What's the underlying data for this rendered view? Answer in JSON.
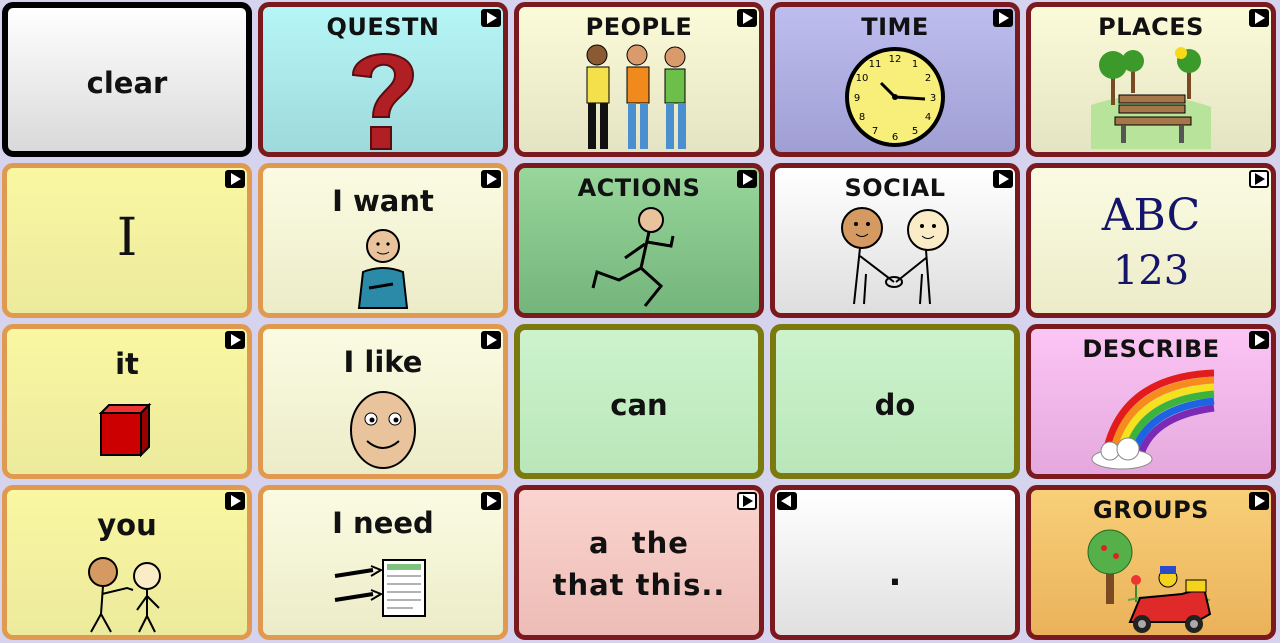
{
  "board": {
    "cells": [
      {
        "id": "clear",
        "label": "clear"
      },
      {
        "id": "questn",
        "label": "QUESTN",
        "picture": "question-mark-icon"
      },
      {
        "id": "people",
        "label": "PEOPLE",
        "picture": "people-icon"
      },
      {
        "id": "time",
        "label": "TIME",
        "picture": "clock-icon"
      },
      {
        "id": "places",
        "label": "PLACES",
        "picture": "park-bench-icon"
      },
      {
        "id": "i",
        "label": "I"
      },
      {
        "id": "i-want",
        "label": "I want",
        "picture": "person-want-icon"
      },
      {
        "id": "actions",
        "label": "ACTIONS",
        "picture": "running-person-icon"
      },
      {
        "id": "social",
        "label": "SOCIAL",
        "picture": "handshake-icon"
      },
      {
        "id": "abc",
        "label": "ABC",
        "label2": "123"
      },
      {
        "id": "it",
        "label": "it",
        "picture": "red-cube-icon"
      },
      {
        "id": "i-like",
        "label": "I like",
        "picture": "smiley-face-icon"
      },
      {
        "id": "can",
        "label": "can"
      },
      {
        "id": "do",
        "label": "do"
      },
      {
        "id": "describe",
        "label": "DESCRIBE",
        "picture": "rainbow-icon"
      },
      {
        "id": "you",
        "label": "you",
        "picture": "pointing-people-icon"
      },
      {
        "id": "i-need",
        "label": "I need",
        "picture": "receipt-hands-icon"
      },
      {
        "id": "articles",
        "label": "a  the",
        "label2": "that this.."
      },
      {
        "id": "period",
        "label": "."
      },
      {
        "id": "groups",
        "label": "GROUPS",
        "picture": "tree-car-icon"
      }
    ],
    "colors": {
      "background": "#d6d3ee",
      "border_maroon": "#7a1a1e",
      "border_orange": "#e09a4f",
      "border_olive": "#7a7a10",
      "border_black": "#000000"
    }
  }
}
